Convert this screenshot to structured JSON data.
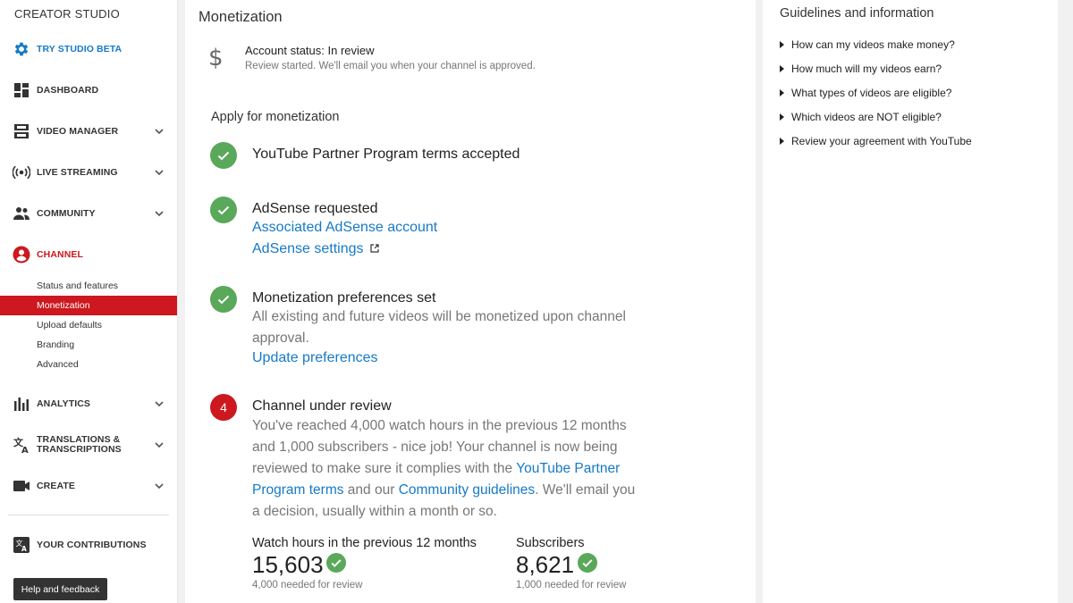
{
  "sidebar": {
    "title": "CREATOR STUDIO",
    "nav": {
      "beta": "TRY STUDIO BETA",
      "dashboard": "DASHBOARD",
      "video_manager": "VIDEO MANAGER",
      "live_streaming": "LIVE STREAMING",
      "community": "COMMUNITY",
      "channel": "CHANNEL",
      "analytics": "ANALYTICS",
      "translations": "TRANSLATIONS & TRANSCRIPTIONS",
      "create": "CREATE",
      "contributions": "YOUR CONTRIBUTIONS"
    },
    "channel_sub": [
      "Status and features",
      "Monetization",
      "Upload defaults",
      "Branding",
      "Advanced"
    ],
    "help": "Help and feedback"
  },
  "main": {
    "title": "Monetization",
    "account_status": "Account status: In review",
    "account_sub": "Review started. We'll email you when your channel is approved.",
    "apply_title": "Apply for monetization",
    "step1": {
      "title": "YouTube Partner Program terms accepted"
    },
    "step2": {
      "title": "AdSense requested",
      "link1": "Associated AdSense account",
      "link2": "AdSense settings"
    },
    "step3": {
      "title": "Monetization preferences set",
      "text": "All existing and future videos will be monetized upon channel approval.",
      "link": "Update preferences"
    },
    "step4": {
      "number": "4",
      "title": "Channel under review",
      "text_a": "You've reached 4,000 watch hours in the previous 12 months and 1,000 subscribers - nice job! Your channel is now being reviewed to make sure it complies with the ",
      "link_a": "YouTube Partner Program terms",
      "text_b": " and our ",
      "link_b": "Community guidelines",
      "text_c": ". We'll email you a decision, usually within a month or so."
    },
    "stats": {
      "watch_label": "Watch hours in the previous 12 months",
      "watch_value": "15,603",
      "watch_sub": "4,000 needed for review",
      "subs_label": "Subscribers",
      "subs_value": "8,621",
      "subs_sub": "1,000 needed for review"
    }
  },
  "right": {
    "title": "Guidelines and information",
    "items": [
      "How can my videos make money?",
      "How much will my videos earn?",
      "What types of videos are eligible?",
      "Which videos are NOT eligible?",
      "Review your agreement with YouTube"
    ]
  },
  "colors": {
    "accent": "#cc181e",
    "link": "#167ac6",
    "success": "#5aa85a"
  }
}
